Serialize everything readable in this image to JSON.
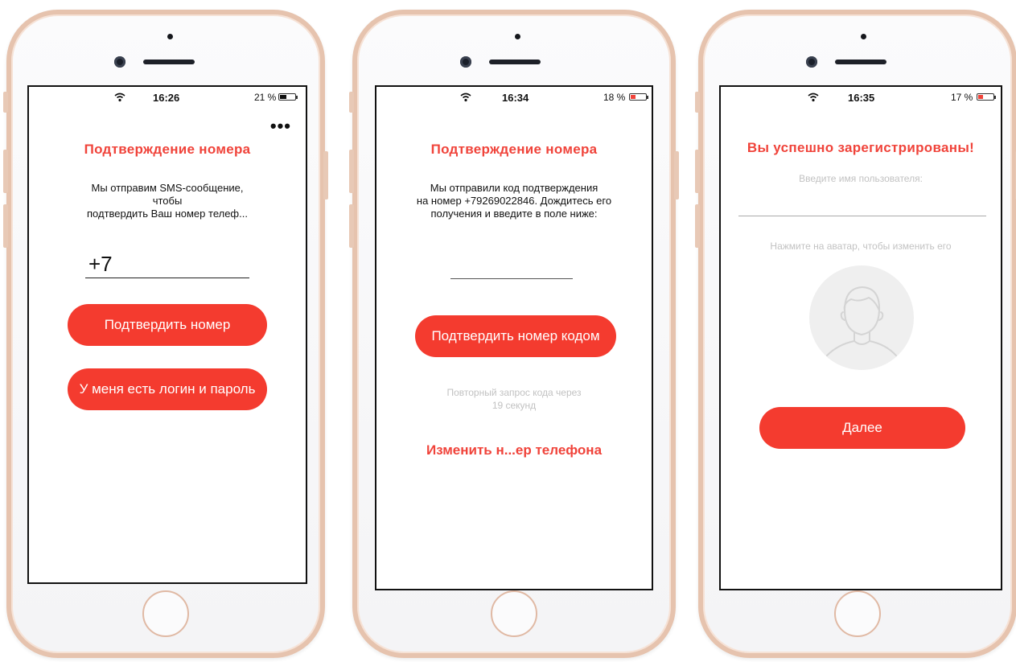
{
  "colors": {
    "accent": "#f43b2f",
    "title_red": "#f0433a",
    "frame_rose_gold": "#e6c3ae"
  },
  "screens": [
    {
      "status": {
        "time": "16:26",
        "battery_pct": "21 %",
        "battery_level": 0.21,
        "battery_color": "#111111"
      },
      "more_icon": "ellipsis-icon",
      "title": "Подтверждение номера",
      "message_lines": [
        "Мы отправим SMS-сообщение,",
        "чтобы",
        "подтвердить Ваш номер телеф..."
      ],
      "phone_value": "+7",
      "confirm_button": "Подтвердить номер",
      "login_button": "У меня есть логин и пароль"
    },
    {
      "status": {
        "time": "16:34",
        "battery_pct": "18 %",
        "battery_level": 0.18,
        "battery_color": "#f0433a"
      },
      "title": "Подтверждение номера",
      "message_lines": [
        "Мы отправили код подтверждения",
        "на номер +79269022846. Дождитесь его",
        "получения и введите в поле ниже:"
      ],
      "code_value": "",
      "confirm_button": "Подтвердить номер кодом",
      "resend_lines": [
        "Повторный запрос кода через",
        "19 секунд"
      ],
      "change_link": "Изменить н...ер телефона"
    },
    {
      "status": {
        "time": "16:35",
        "battery_pct": "17 %",
        "battery_level": 0.17,
        "battery_color": "#f0433a"
      },
      "title": "Вы успешно зарегистрированы!",
      "username_placeholder": "Введите имя пользователя:",
      "avatar_hint": "Нажмите на аватар, чтобы изменить его",
      "avatar_icon": "user-avatar-icon",
      "next_button": "Далее"
    }
  ]
}
